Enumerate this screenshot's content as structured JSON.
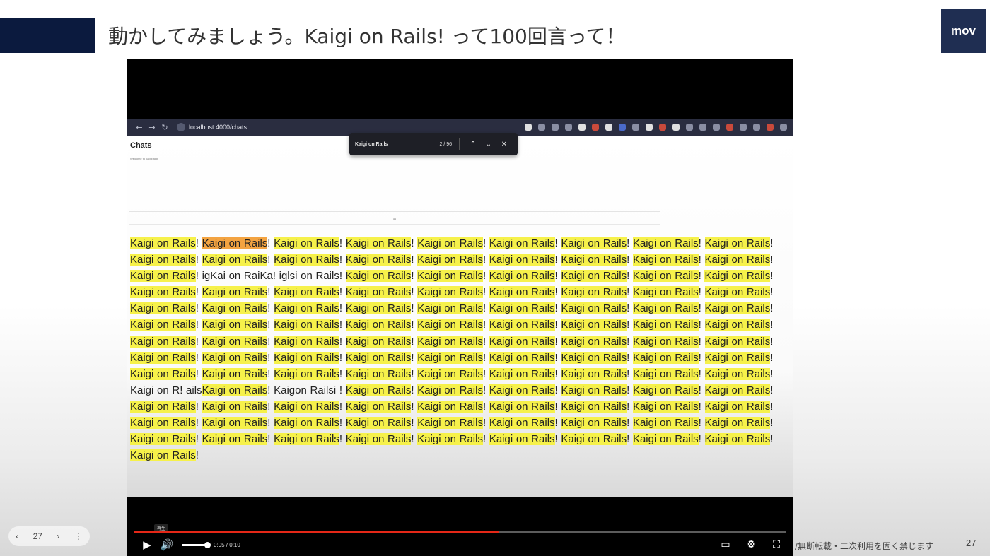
{
  "slide": {
    "title": "動かしてみましょう。Kaigi on Rails! って100回言って！",
    "logo": "mov",
    "footer_note": "/無断転載・二次利用を固く禁じます",
    "page_number": "27"
  },
  "browser": {
    "url": "localhost:4000/chats",
    "find_query": "Kaigi on Rails",
    "find_count": "2 / 96"
  },
  "page": {
    "heading": "Chats",
    "welcome": "Welcome to kaigipapp!"
  },
  "content": {
    "segments": [
      {
        "t": "Kaigi on Rails",
        "hl": "y"
      },
      {
        "t": "! "
      },
      {
        "t": "Kaigi on Rails",
        "hl": "o"
      },
      {
        "t": "! "
      },
      {
        "t": "Kaigi on Rails",
        "hl": "y"
      },
      {
        "t": "! "
      },
      {
        "t": "Kaigi on Rails",
        "hl": "y"
      },
      {
        "t": "! "
      },
      {
        "t": "Kaigi on Rails",
        "hl": "y"
      },
      {
        "t": "! "
      },
      {
        "t": "Kaigi on Rails",
        "hl": "y"
      },
      {
        "t": "! "
      },
      {
        "t": "Kaigi on Rails",
        "hl": "y"
      },
      {
        "t": "! "
      },
      {
        "t": "Kaigi on Rails",
        "hl": "y"
      },
      {
        "t": "! "
      },
      {
        "t": "Kaigi on Rails",
        "hl": "y"
      },
      {
        "t": "! "
      },
      {
        "t": "Kaigi on Rails",
        "hl": "y"
      },
      {
        "t": "! "
      },
      {
        "t": "Kaigi on Rails",
        "hl": "y"
      },
      {
        "t": "! "
      },
      {
        "t": "Kaigi on Rails",
        "hl": "y"
      },
      {
        "t": "! "
      },
      {
        "t": "Kaigi on Rails",
        "hl": "y"
      },
      {
        "t": "! "
      },
      {
        "t": "Kaigi on Rails",
        "hl": "y"
      },
      {
        "t": "! "
      },
      {
        "t": "Kaigi on Rails",
        "hl": "y"
      },
      {
        "t": "! "
      },
      {
        "t": "Kaigi on Rails",
        "hl": "y"
      },
      {
        "t": "! "
      },
      {
        "t": "Kaigi on Rails",
        "hl": "y"
      },
      {
        "t": "! "
      },
      {
        "t": "Kaigi on Rails",
        "hl": "y"
      },
      {
        "t": "! "
      },
      {
        "t": "Kaigi on Rails",
        "hl": "y"
      },
      {
        "t": "! "
      },
      {
        "t": "igKai on RaiKa! iglsi on Rails! "
      },
      {
        "t": "Kaigi on Rails",
        "hl": "y"
      },
      {
        "t": "! "
      },
      {
        "t": "Kaigi on Rails",
        "hl": "y"
      },
      {
        "t": "! "
      },
      {
        "t": "Kaigi on Rails",
        "hl": "y"
      },
      {
        "t": "! "
      },
      {
        "t": "Kaigi on Rails",
        "hl": "y"
      },
      {
        "t": "! "
      },
      {
        "t": "Kaigi on Rails",
        "hl": "y"
      },
      {
        "t": "! "
      },
      {
        "t": "Kaigi on Rails",
        "hl": "y"
      },
      {
        "t": "! "
      },
      {
        "t": "Kaigi on Rails",
        "hl": "y"
      },
      {
        "t": "! "
      },
      {
        "t": "Kaigi on Rails",
        "hl": "y"
      },
      {
        "t": "! "
      },
      {
        "t": "Kaigi on Rails",
        "hl": "y"
      },
      {
        "t": "! "
      },
      {
        "t": "Kaigi on Rails",
        "hl": "y"
      },
      {
        "t": "! "
      },
      {
        "t": "Kaigi on Rails",
        "hl": "y"
      },
      {
        "t": "! "
      },
      {
        "t": "Kaigi on Rails",
        "hl": "y"
      },
      {
        "t": "! "
      },
      {
        "t": "Kaigi on Rails",
        "hl": "y"
      },
      {
        "t": "! "
      },
      {
        "t": "Kaigi on Rails",
        "hl": "y"
      },
      {
        "t": "! "
      },
      {
        "t": "Kaigi on Rails",
        "hl": "y"
      },
      {
        "t": "! "
      },
      {
        "t": "Kaigi on Rails",
        "hl": "y"
      },
      {
        "t": "! "
      },
      {
        "t": "Kaigi on Rails",
        "hl": "y"
      },
      {
        "t": "! "
      },
      {
        "t": "Kaigi on Rails",
        "hl": "y"
      },
      {
        "t": "! "
      },
      {
        "t": "Kaigi on Rails",
        "hl": "y"
      },
      {
        "t": "! "
      },
      {
        "t": "Kaigi on Rails",
        "hl": "y"
      },
      {
        "t": "! "
      },
      {
        "t": "Kaigi on Rails",
        "hl": "y"
      },
      {
        "t": "! "
      },
      {
        "t": "Kaigi on Rails",
        "hl": "y"
      },
      {
        "t": "! "
      },
      {
        "t": "Kaigi on Rails",
        "hl": "y"
      },
      {
        "t": "! "
      },
      {
        "t": "Kaigi on Rails",
        "hl": "y"
      },
      {
        "t": "! "
      },
      {
        "t": "Kaigi on Rails",
        "hl": "y"
      },
      {
        "t": "! "
      },
      {
        "t": "Kaigi on Rails",
        "hl": "y"
      },
      {
        "t": "! "
      },
      {
        "t": "Kaigi on Rails",
        "hl": "y"
      },
      {
        "t": "! "
      },
      {
        "t": "Kaigi on Rails",
        "hl": "y"
      },
      {
        "t": "! "
      },
      {
        "t": "Kaigi on Rails",
        "hl": "y"
      },
      {
        "t": "! "
      },
      {
        "t": "Kaigi on Rails",
        "hl": "y"
      },
      {
        "t": "! "
      },
      {
        "t": "Kaigi on Rails",
        "hl": "y"
      },
      {
        "t": "! "
      },
      {
        "t": "Kaigi on Rails",
        "hl": "y"
      },
      {
        "t": "! "
      },
      {
        "t": "Kaigi on Rails",
        "hl": "y"
      },
      {
        "t": "! "
      },
      {
        "t": "Kaigi on Rails",
        "hl": "y"
      },
      {
        "t": "! "
      },
      {
        "t": "Kaigi on Rails",
        "hl": "y"
      },
      {
        "t": "! "
      },
      {
        "t": "Kaigi on Rails",
        "hl": "y"
      },
      {
        "t": "! "
      },
      {
        "t": "Kaigi on Rails",
        "hl": "y"
      },
      {
        "t": "! "
      },
      {
        "t": "Kaigi on Rails",
        "hl": "y"
      },
      {
        "t": "! "
      },
      {
        "t": "Kaigi on Rails",
        "hl": "y"
      },
      {
        "t": "! "
      },
      {
        "t": "Kaigi on Rails",
        "hl": "y"
      },
      {
        "t": "! "
      },
      {
        "t": "Kaigi on Rails",
        "hl": "y"
      },
      {
        "t": "! "
      },
      {
        "t": "Kaigi on Rails",
        "hl": "y"
      },
      {
        "t": "! "
      },
      {
        "t": "Kaigi on Rails",
        "hl": "y"
      },
      {
        "t": "! "
      },
      {
        "t": "Kaigi on Rails",
        "hl": "y"
      },
      {
        "t": "! "
      },
      {
        "t": "Kaigi on Rails",
        "hl": "y"
      },
      {
        "t": "! "
      },
      {
        "t": "Kaigi on Rails",
        "hl": "y"
      },
      {
        "t": "! "
      },
      {
        "t": "Kaigi on Rails",
        "hl": "y"
      },
      {
        "t": "! "
      },
      {
        "t": "Kaigi on Rails",
        "hl": "y"
      },
      {
        "t": "! "
      },
      {
        "t": "Kaigi on Rails",
        "hl": "y"
      },
      {
        "t": "! "
      },
      {
        "t": "Kaigi on Rails",
        "hl": "y"
      },
      {
        "t": "! "
      },
      {
        "t": "Kaigi on Rails",
        "hl": "y"
      },
      {
        "t": "! "
      },
      {
        "t": "Kaigi on Rails",
        "hl": "y"
      },
      {
        "t": "! "
      },
      {
        "t": "Kaigi on Rails",
        "hl": "y"
      },
      {
        "t": "! "
      },
      {
        "t": "Kaigi on Rails",
        "hl": "y"
      },
      {
        "t": "! "
      },
      {
        "t": "Kaigi on Rails",
        "hl": "y"
      },
      {
        "t": "! "
      },
      {
        "t": "Kaigi on Rails",
        "hl": "y"
      },
      {
        "t": "! "
      },
      {
        "t": "Kaigi on Rails",
        "hl": "y"
      },
      {
        "t": "! "
      },
      {
        "t": "Kaigi on Rails",
        "hl": "y"
      },
      {
        "t": "! "
      },
      {
        "t": "Kaigi on Rails",
        "hl": "y"
      },
      {
        "t": "! "
      },
      {
        "t": "Kaigi on Rails",
        "hl": "y"
      },
      {
        "t": "! "
      },
      {
        "t": "Kaigi on R! ails"
      },
      {
        "t": "Kaigi on Rails",
        "hl": "y"
      },
      {
        "t": "! "
      },
      {
        "t": "Kaigon Railsi ! "
      },
      {
        "t": "Kaigi on Rails",
        "hl": "y"
      },
      {
        "t": "! "
      },
      {
        "t": "Kaigi on Rails",
        "hl": "y"
      },
      {
        "t": "! "
      },
      {
        "t": "Kaigi on Rails",
        "hl": "y"
      },
      {
        "t": "! "
      },
      {
        "t": "Kaigi on Rails",
        "hl": "y"
      },
      {
        "t": "! "
      },
      {
        "t": "Kaigi on Rails",
        "hl": "y"
      },
      {
        "t": "! "
      },
      {
        "t": "Kaigi on Rails",
        "hl": "y"
      },
      {
        "t": "! "
      },
      {
        "t": "Kaigi on Rails",
        "hl": "y"
      },
      {
        "t": "! "
      },
      {
        "t": "Kaigi on Rails",
        "hl": "y"
      },
      {
        "t": "! "
      },
      {
        "t": "Kaigi on Rails",
        "hl": "y"
      },
      {
        "t": "! "
      },
      {
        "t": "Kaigi on Rails",
        "hl": "y"
      },
      {
        "t": "! "
      },
      {
        "t": "Kaigi on Rails",
        "hl": "y"
      },
      {
        "t": "! "
      },
      {
        "t": "Kaigi on Rails",
        "hl": "y"
      },
      {
        "t": "! "
      },
      {
        "t": "Kaigi on Rails",
        "hl": "y"
      },
      {
        "t": "! "
      },
      {
        "t": "Kaigi on Rails",
        "hl": "y"
      },
      {
        "t": "! "
      },
      {
        "t": "Kaigi on Rails",
        "hl": "y"
      },
      {
        "t": "! "
      },
      {
        "t": "Kaigi on Rails",
        "hl": "y"
      },
      {
        "t": "! "
      },
      {
        "t": "Kaigi on Rails",
        "hl": "y"
      },
      {
        "t": "! "
      },
      {
        "t": "Kaigi on Rails",
        "hl": "y"
      },
      {
        "t": "! "
      },
      {
        "t": "Kaigi on Rails",
        "hl": "y"
      },
      {
        "t": "! "
      },
      {
        "t": "Kaigi on Rails",
        "hl": "y"
      },
      {
        "t": "! "
      },
      {
        "t": "Kaigi on Rails",
        "hl": "y"
      },
      {
        "t": "! "
      },
      {
        "t": "Kaigi on Rails",
        "hl": "y"
      },
      {
        "t": "! "
      },
      {
        "t": "Kaigi on Rails",
        "hl": "y"
      },
      {
        "t": "! "
      },
      {
        "t": "Kaigi on Rails",
        "hl": "y"
      },
      {
        "t": "! "
      },
      {
        "t": "Kaigi on Rails",
        "hl": "y"
      },
      {
        "t": "! "
      },
      {
        "t": "Kaigi on Rails",
        "hl": "y"
      },
      {
        "t": "! "
      },
      {
        "t": "Kaigi on Rails",
        "hl": "y"
      },
      {
        "t": "! "
      },
      {
        "t": "Kaigi on Rails",
        "hl": "y"
      },
      {
        "t": "! "
      },
      {
        "t": "Kaigi on Rails",
        "hl": "y"
      },
      {
        "t": "! "
      },
      {
        "t": "Kaigi on Rails",
        "hl": "y"
      },
      {
        "t": "! "
      },
      {
        "t": "Kaigi on Rails",
        "hl": "y"
      },
      {
        "t": "! "
      },
      {
        "t": "Kaigi on Rails",
        "hl": "y"
      },
      {
        "t": "! "
      },
      {
        "t": "Kaigi on Rails",
        "hl": "y"
      },
      {
        "t": "! "
      },
      {
        "t": "Kaigi on Rails",
        "hl": "y"
      },
      {
        "t": "!"
      }
    ]
  },
  "player": {
    "tooltip": "再生",
    "time": "0:05 / 0:10",
    "progress": 0.56,
    "volume": 1.0
  },
  "slide_nav": {
    "prev": "‹",
    "page": "27",
    "next": "›",
    "more": "⋮"
  },
  "colors": {
    "highlight": "#f6f14a",
    "current_highlight": "#f3a341",
    "progress": "#e52717",
    "header_block": "#0b1a3e",
    "logo_bg": "#1f2e52"
  }
}
